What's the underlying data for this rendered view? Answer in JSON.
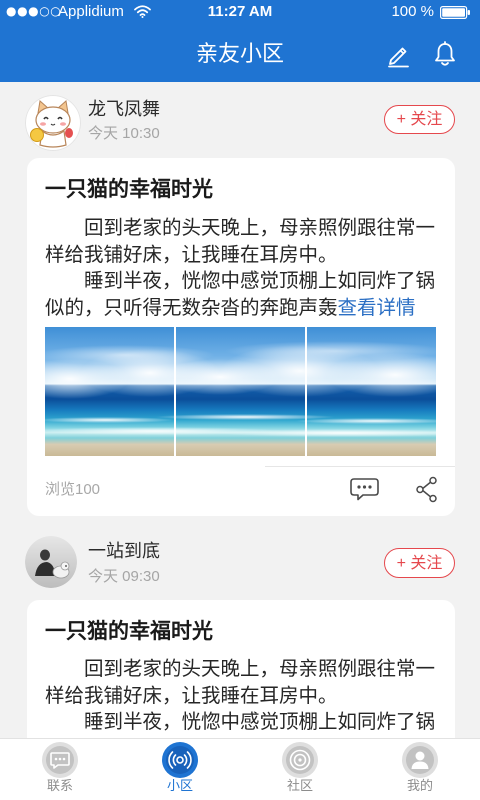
{
  "theme": {
    "primary": "#1f74d2",
    "follow": "#e5484d",
    "link": "#2b6fc4",
    "tab_inactive": "#c2c2c2"
  },
  "status_bar": {
    "signal": "●●●○○",
    "carrier": "Applidium",
    "time": "11:27 AM",
    "battery": "100 %",
    "wifi_icon": "wifi-icon",
    "battery_icon": "battery-icon"
  },
  "header": {
    "title": "亲友小区",
    "actions": [
      {
        "icon": "pencil-icon"
      },
      {
        "icon": "bell-icon"
      }
    ]
  },
  "posts": [
    {
      "author": "龙飞凤舞",
      "time": "今天 10:30",
      "follow_label": "+ 关注",
      "title": "一只猫的幸福时光",
      "paragraphs": [
        "回到老家的头天晚上，母亲照例跟往常一样给我铺好床，让我睡在耳房中。",
        "睡到半夜，恍惚中感觉顶棚上如同炸了锅似的，只听得无数杂沓的奔跑声轰"
      ],
      "more_label": "查看详情",
      "views": "浏览100",
      "actions": [
        {
          "icon": "comment-icon"
        },
        {
          "icon": "share-icon"
        }
      ]
    },
    {
      "author": "一站到底",
      "time": "今天 09:30",
      "follow_label": "+ 关注",
      "title": "一只猫的幸福时光",
      "paragraphs": [
        "回到老家的头天晚上，母亲照例跟往常一样给我铺好床，让我睡在耳房中。",
        "睡到半夜，恍惚中感觉顶棚上如同炸了锅"
      ]
    }
  ],
  "tab_bar": {
    "tabs": [
      {
        "label": "联系",
        "icon": "chat-icon",
        "active": false
      },
      {
        "label": "小区",
        "icon": "community-icon",
        "active": true
      },
      {
        "label": "社区",
        "icon": "rings-icon",
        "active": false
      },
      {
        "label": "我的",
        "icon": "person-icon",
        "active": false
      }
    ]
  }
}
